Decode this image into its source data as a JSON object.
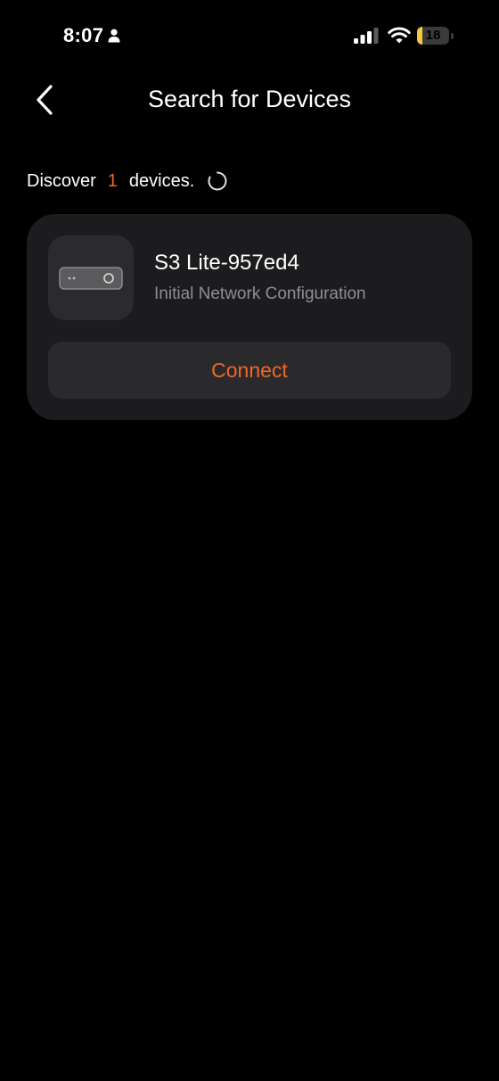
{
  "status_bar": {
    "time": "8:07",
    "battery_level": "18",
    "battery_fraction": 0.18,
    "icons": {
      "person": "person-icon",
      "signal": "cellular-signal-icon",
      "wifi": "wifi-icon",
      "battery": "battery-icon"
    },
    "colors": {
      "battery_fill": "#f6c943"
    }
  },
  "nav": {
    "back_icon": "chevron-left-icon",
    "title": "Search for Devices"
  },
  "discovery": {
    "prefix": "Discover",
    "count": "1",
    "suffix": "devices.",
    "spinner_icon": "loading-spinner-icon"
  },
  "devices": [
    {
      "icon": "device-box-icon",
      "name": "S3 Lite-957ed4",
      "status": "Initial Network Configuration",
      "action_label": "Connect"
    }
  ],
  "colors": {
    "background": "#000000",
    "card": "#1c1c1e",
    "accent": "#f0662a",
    "secondary_text": "#8e8e93"
  }
}
